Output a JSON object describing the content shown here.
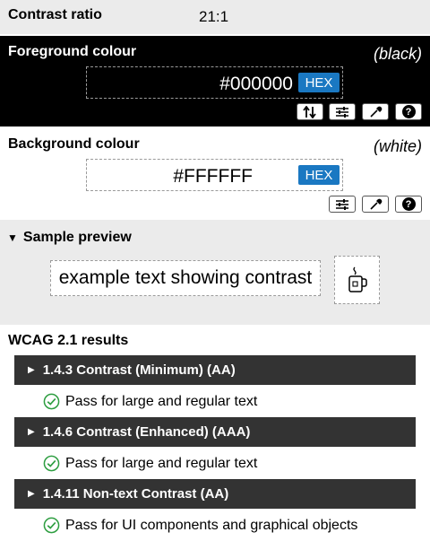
{
  "contrast": {
    "label": "Contrast ratio",
    "value": "21:1"
  },
  "foreground": {
    "title": "Foreground colour",
    "name": "(black)",
    "hex": "#000000",
    "format_button": "HEX",
    "color": "#000000"
  },
  "background": {
    "title": "Background colour",
    "name": "(white)",
    "hex": "#FFFFFF",
    "format_button": "HEX",
    "color": "#FFFFFF"
  },
  "toolbar": {
    "help_label": "?"
  },
  "preview": {
    "title": "Sample preview",
    "sample_text": "example text showing contrast",
    "icon": "coffee-cup-icon"
  },
  "wcag": {
    "title": "WCAG 2.1 results",
    "criteria": [
      {
        "label": "1.4.3 Contrast (Minimum) (AA)",
        "result": "Pass for large and regular text"
      },
      {
        "label": "1.4.6 Contrast (Enhanced) (AAA)",
        "result": "Pass for large and regular text"
      },
      {
        "label": "1.4.11 Non-text Contrast (AA)",
        "result": "Pass for UI components and graphical objects"
      }
    ]
  },
  "colors": {
    "accent": "#1a78c2",
    "pass": "#2e9e41",
    "criteria_bar": "#333333"
  }
}
